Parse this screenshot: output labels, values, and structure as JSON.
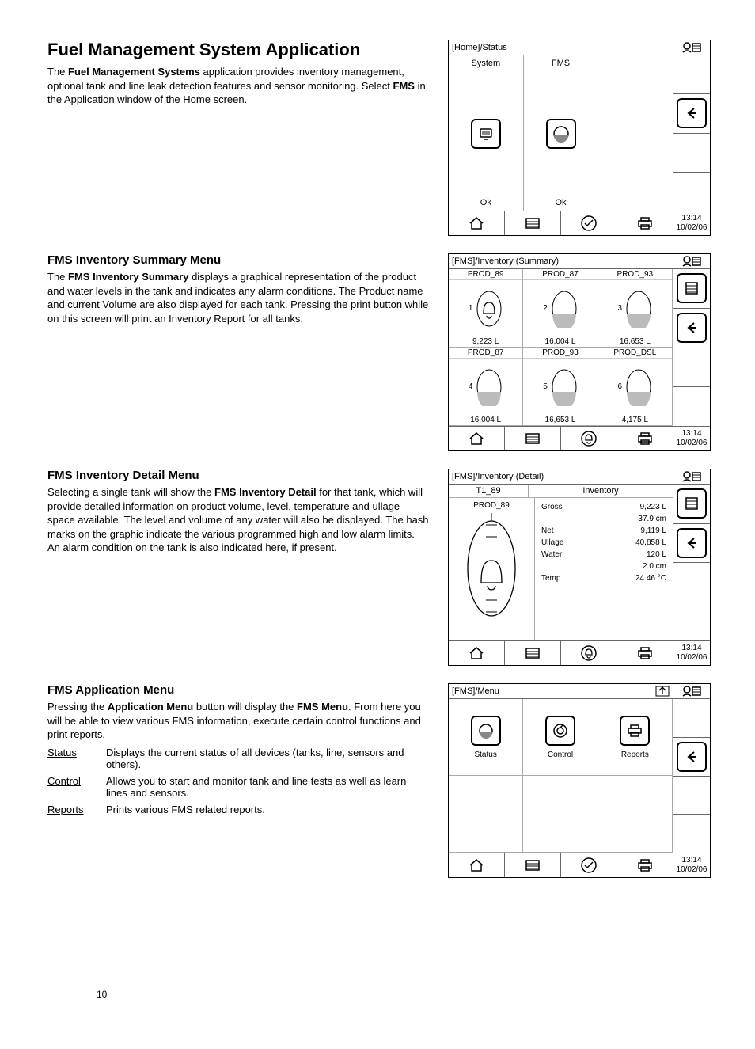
{
  "page_number": "10",
  "section1": {
    "title": "Fuel Management System Application",
    "body_html": "The <b>Fuel Management Systems</b> application provides inventory management, optional tank and line leak detection features and sensor monitoring. Select <b>FMS</b> in the Application window of the Home screen.",
    "screen": {
      "path": "[Home]/Status",
      "tiles": [
        {
          "label": "System",
          "status": "Ok"
        },
        {
          "label": "FMS",
          "status": "Ok"
        },
        {
          "label": "",
          "status": ""
        }
      ],
      "time": "13:14",
      "date": "10/02/06"
    }
  },
  "section2": {
    "title": "FMS Inventory Summary Menu",
    "body_html": "The <b>FMS Inventory Summary</b> displays a graphical representation of the product and water levels in the tank and indicates any alarm conditions. The Product name and current Volume are also displayed for each tank. Pressing the print button while on this screen will print an Inventory Report for all tanks.",
    "screen": {
      "path": "[FMS]/Inventory (Summary)",
      "tanks": [
        {
          "num": "1",
          "prod": "PROD_89",
          "vol": "9,223 L",
          "alarm": true
        },
        {
          "num": "2",
          "prod": "PROD_87",
          "vol": "16,004 L",
          "alarm": false
        },
        {
          "num": "3",
          "prod": "PROD_93",
          "vol": "16,653 L",
          "alarm": false
        },
        {
          "num": "4",
          "prod": "PROD_87",
          "vol": "16,004 L",
          "alarm": false
        },
        {
          "num": "5",
          "prod": "PROD_93",
          "vol": "16,653 L",
          "alarm": false
        },
        {
          "num": "6",
          "prod": "PROD_DSL",
          "vol": "4,175 L",
          "alarm": false
        }
      ],
      "time": "13:14",
      "date": "10/02/06"
    }
  },
  "section3": {
    "title": "FMS Inventory Detail Menu",
    "body_html": "Selecting a single tank will show the <b>FMS Inventory Detail</b> for that tank, which will provide detailed information on product volume, level, temperature and ullage space available. The level and volume of any water will also be displayed. The hash marks on the graphic indicate the various programmed high and low alarm limits. An alarm condition on the tank is also indicated here, if present.",
    "screen": {
      "path": "[FMS]/Inventory (Detail)",
      "tank_tab": "T1_89",
      "inv_tab": "Inventory",
      "prod": "PROD_89",
      "rows": [
        {
          "label": "Gross",
          "value": "9,223 L"
        },
        {
          "label": "",
          "value": "37.9 cm"
        },
        {
          "label": "Net",
          "value": "9,119 L"
        },
        {
          "label": "Ullage",
          "value": "40,858 L"
        },
        {
          "label": "Water",
          "value": "120 L"
        },
        {
          "label": "",
          "value": "2.0 cm"
        },
        {
          "label": "Temp.",
          "value": "24.46 °C"
        }
      ],
      "time": "13:14",
      "date": "10/02/06"
    }
  },
  "section4": {
    "title": "FMS Application Menu",
    "body_html": "Pressing the <b>Application Menu</b> button will display the <b>FMS Menu</b>. From here you will be able to view various FMS information, execute certain control functions and print reports.",
    "items": [
      {
        "term": "Status",
        "def": "Displays the current status of all devices (tanks, line, sensors and others)."
      },
      {
        "term": "Control",
        "def": "Allows you to start and monitor tank and line tests as well as learn lines and sensors."
      },
      {
        "term": "Reports",
        "def": "Prints various FMS related reports."
      }
    ],
    "screen": {
      "path": "[FMS]/Menu",
      "tiles": [
        "Status",
        "Control",
        "Reports"
      ],
      "time": "13:14",
      "date": "10/02/06"
    }
  }
}
